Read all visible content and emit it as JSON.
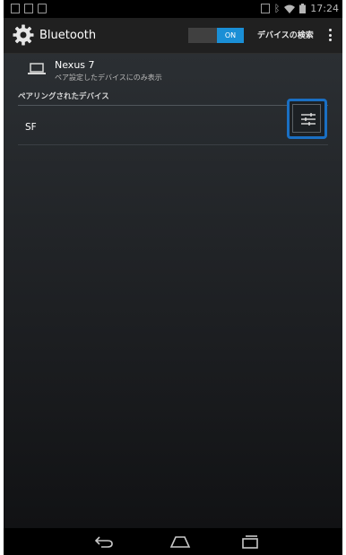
{
  "status_bar": {
    "time": "17:24"
  },
  "action_bar": {
    "title": "Bluetooth",
    "toggle_label": "ON",
    "search_label": "デバイスの検索"
  },
  "this_device": {
    "name": "Nexus 7",
    "subtitle": "ペア設定したデバイスにのみ表示"
  },
  "paired_section": {
    "header": "ペアリングされたデバイス",
    "devices": [
      {
        "name": "SF"
      }
    ]
  },
  "colors": {
    "accent": "#1a8fd6",
    "highlight_border": "#1a6fc3",
    "action_bar_bg": "#202020"
  },
  "icons": {
    "gear": "gear-icon",
    "laptop": "laptop-icon",
    "tune": "tune-icon",
    "back": "back-icon",
    "home": "home-icon",
    "recents": "recents-icon"
  }
}
